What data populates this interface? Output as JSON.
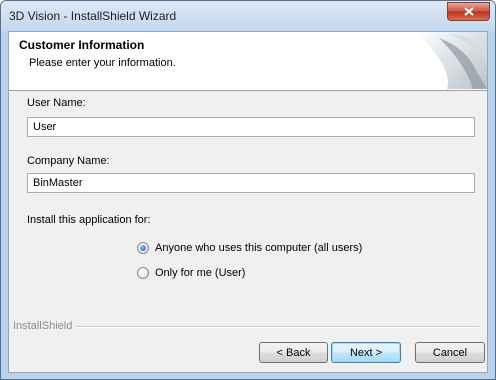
{
  "window": {
    "title": "3D Vision - InstallShield Wizard",
    "close_glyph": "x"
  },
  "header": {
    "title": "Customer Information",
    "subtitle": "Please enter your information."
  },
  "form": {
    "user_name_label": "User Name:",
    "user_name_value": "User",
    "company_name_label": "Company Name:",
    "company_name_value": "BinMaster",
    "install_for_label": "Install this application for:",
    "options": [
      {
        "label": "Anyone who uses this computer (all users)",
        "selected": true
      },
      {
        "label": "Only for me (User)",
        "selected": false
      }
    ]
  },
  "branding": "InstallShield",
  "buttons": {
    "back": "< Back",
    "next": "Next >",
    "cancel": "Cancel"
  },
  "colors": {
    "client_bg": "#f0f0f0",
    "frame": "#b9d1ea",
    "close": "#c7523d"
  }
}
